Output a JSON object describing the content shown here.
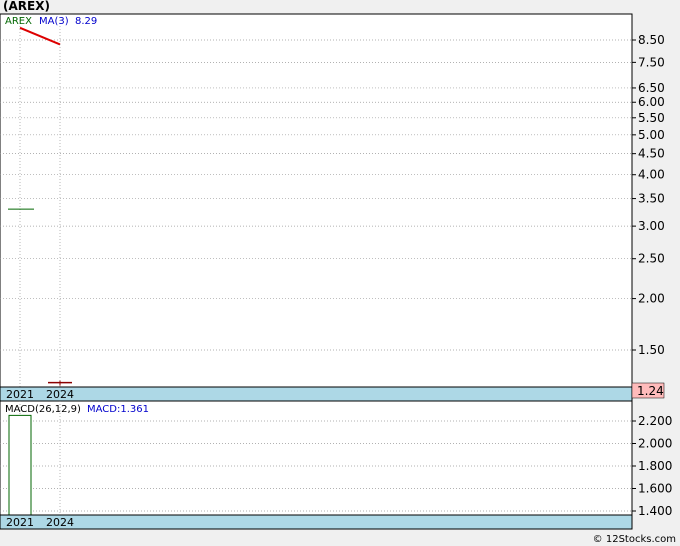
{
  "header": {
    "ticker": "(AREX)"
  },
  "footer": {
    "credit": "© 12Stocks.com"
  },
  "chart_data": [
    {
      "type": "line",
      "panel": "price",
      "scale": "log",
      "ylim": [
        1.25,
        10
      ],
      "x_years": [
        "2021",
        "2024"
      ],
      "y_ticks": [
        "8.50",
        "7.50",
        "6.50",
        "6.00",
        "5.50",
        "5.00",
        "4.50",
        "4.00",
        "3.50",
        "3.00",
        "2.50",
        "2.00",
        "1.50"
      ],
      "legend": {
        "symbol": "AREX",
        "ma_label": "MA(3)",
        "ma_value": "8.29"
      },
      "last_price_badge": "1.24",
      "series": [
        {
          "name": "AREX",
          "kind": "tick",
          "points": [
            {
              "x": "2021",
              "y": 3.3
            },
            {
              "x": "2024",
              "y": 1.25
            }
          ]
        },
        {
          "name": "MA(3)",
          "kind": "line",
          "points": [
            {
              "x": "2021",
              "y": 9.1
            },
            {
              "x": "2024",
              "y": 8.29
            }
          ]
        }
      ],
      "grid": true,
      "colors": {
        "price": "#006600",
        "last_price": "#8b0000",
        "ma": "#dd0000",
        "ma_label": "#0000cc",
        "badge": "#ffbbbb",
        "axis_band": "#add8e6"
      }
    },
    {
      "type": "bar",
      "panel": "macd",
      "ylim": [
        1.3,
        2.3
      ],
      "x_years": [
        "2021",
        "2024"
      ],
      "y_ticks": [
        "2.200",
        "2.000",
        "1.800",
        "1.600",
        "1.400"
      ],
      "legend": {
        "label": "MACD(26,12,9)",
        "value_label": "MACD:1.361"
      },
      "series": [
        {
          "name": "MACD",
          "points": [
            {
              "x": "2021",
              "y": 2.25
            }
          ]
        }
      ],
      "grid": true
    }
  ]
}
